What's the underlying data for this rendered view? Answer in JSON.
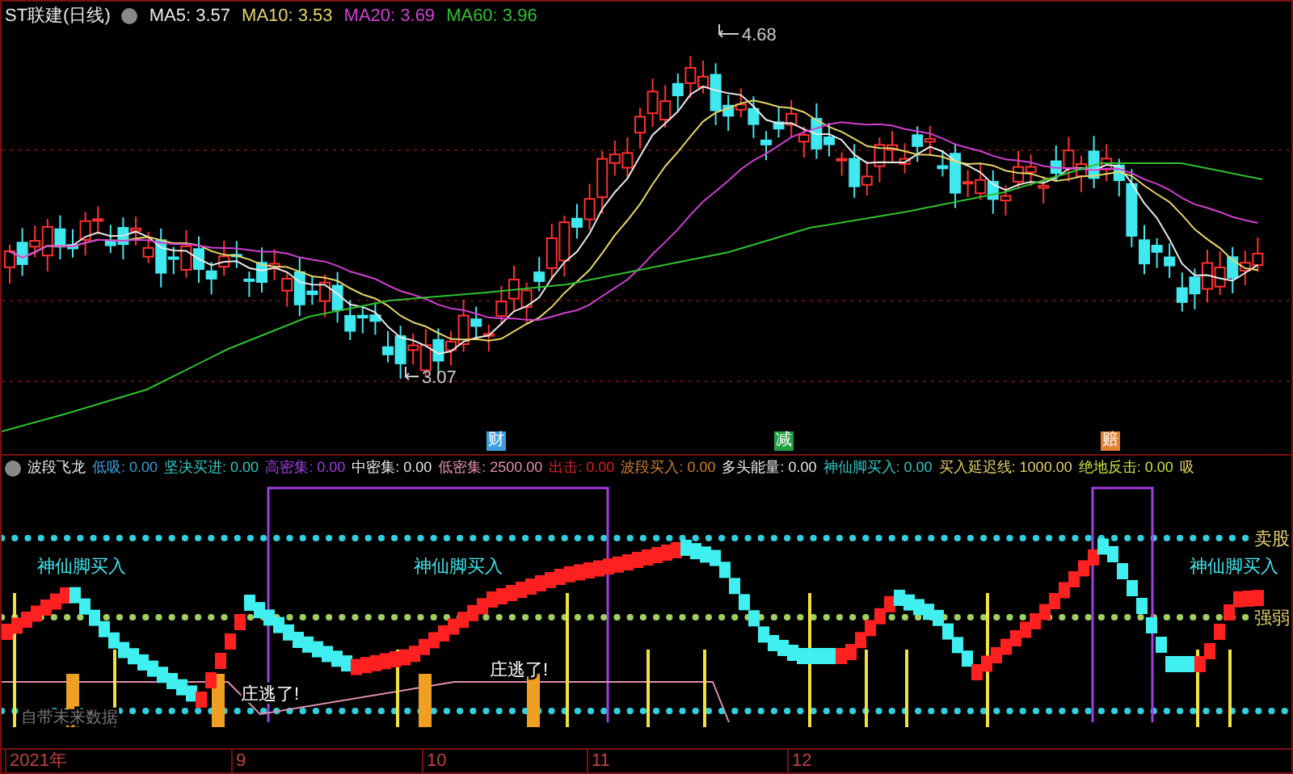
{
  "main_chart": {
    "title": "ST联建(日线)",
    "moving_averages": [
      {
        "label": "MA5: 3.57",
        "color": "#e8e8e8"
      },
      {
        "label": "MA10: 3.53",
        "color": "#e6d36a"
      },
      {
        "label": "MA20: 3.69",
        "color": "#d040d0"
      },
      {
        "label": "MA60: 3.96",
        "color": "#30c030"
      }
    ],
    "high_label": "4.68",
    "low_label": "3.07",
    "event_markers": [
      {
        "label": "财",
        "color": "#3aa0e0"
      },
      {
        "label": "减",
        "color": "#20a040"
      },
      {
        "label": "赔",
        "color": "#e08030"
      }
    ]
  },
  "indicator": {
    "title": "波段飞龙",
    "values": [
      {
        "label": "低吸: 0.00",
        "color": "#3aa0e0"
      },
      {
        "label": "坚决买进: 0.00",
        "color": "#30c8c8"
      },
      {
        "label": "高密集: 0.00",
        "color": "#a040e0"
      },
      {
        "label": "中密集: 0.00",
        "color": "#e8e8e8"
      },
      {
        "label": "低密集: 2500.00",
        "color": "#e090b0"
      },
      {
        "label": "出击: 0.00",
        "color": "#e02020"
      },
      {
        "label": "波段买入: 0.00",
        "color": "#d08030"
      },
      {
        "label": "多头能量: 0.00",
        "color": "#e8e8e8"
      },
      {
        "label": "神仙脚买入: 0.00",
        "color": "#30c8c8"
      },
      {
        "label": "买入延迟线: 1000.00",
        "color": "#e6d36a"
      },
      {
        "label": "绝地反击: 0.00",
        "color": "#d0e040"
      },
      {
        "label": "吸",
        "color": "#e6d36a"
      }
    ],
    "signals": [
      "神仙脚买入",
      "神仙脚买入",
      "神仙脚买入"
    ],
    "line_labels": [
      "卖股",
      "强弱"
    ],
    "escape_labels": [
      "庄逃了!",
      "庄逃了!"
    ],
    "note": "自带未来数据"
  },
  "time_axis": [
    "2021年",
    "9",
    "10",
    "11",
    "12"
  ]
}
